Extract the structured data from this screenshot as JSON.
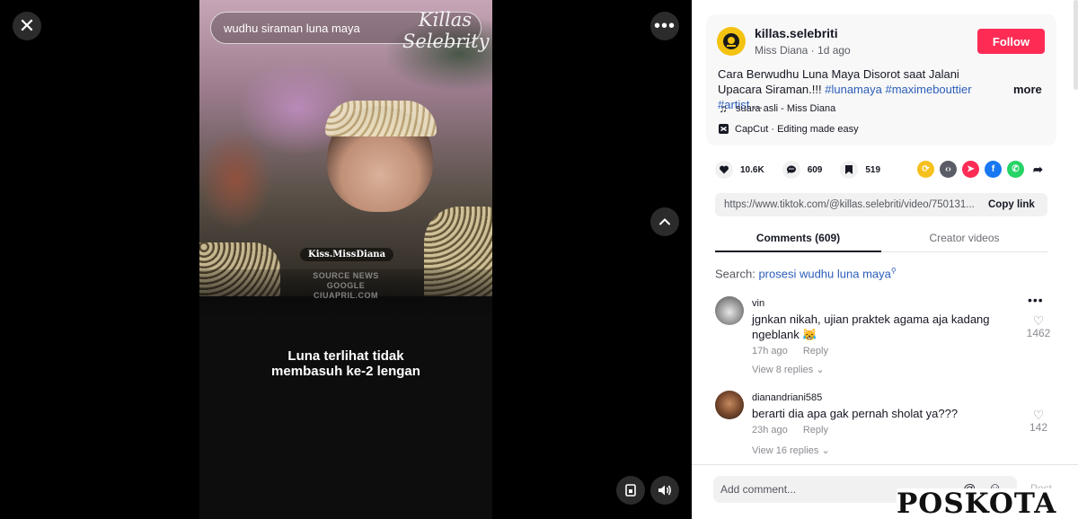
{
  "video": {
    "search_text": "wudhu siraman luna maya",
    "brand_overlay": "Killas Selebrity",
    "watermark": "Kiss.MissDiana",
    "source_lines": [
      "SOURCE NEWS",
      "GOOGLE",
      "CIUAPRIL.COM"
    ],
    "caption_line1": "Luna terlihat tidak",
    "caption_line2": "membasuh ke-2 lengan"
  },
  "post": {
    "username": "killas.selebriti",
    "subline": "Miss Diana · 1d ago",
    "follow_label": "Follow",
    "description": "Cara Berwudhu Luna Maya Disorot saat Jalani Upacara Siraman.!!!",
    "hashtags": [
      "#lunamaya",
      "#maximebouttier",
      "#artist"
    ],
    "ellipsis": "...",
    "more_label": "more",
    "music": "suara asli - Miss Diana",
    "capcut": "CapCut · Editing made easy"
  },
  "actions": {
    "likes": "10.6K",
    "comments": "609",
    "saves": "519"
  },
  "share_colors": [
    "#f7c01e",
    "#5a5c66",
    "#fe2c55",
    "#1877f2",
    "#25d366"
  ],
  "link": {
    "url": "https://www.tiktok.com/@killas.selebriti/video/750131...",
    "copy_label": "Copy link"
  },
  "tabs": {
    "comments": "Comments (609)",
    "creator": "Creator videos"
  },
  "comment_search": {
    "prefix": "Search:",
    "query": "prosesi wudhu luna maya"
  },
  "comments": [
    {
      "user": "vin",
      "text": "jgnkan nikah, ujian praktek agama aja kadang ngeblank 😹",
      "time": "17h ago",
      "reply_label": "Reply",
      "view_replies": "View 8 replies",
      "likes": "1462"
    },
    {
      "user": "dianandriani585",
      "text": "berarti dia apa gak pernah sholat ya???",
      "time": "23h ago",
      "reply_label": "Reply",
      "view_replies": "View 16 replies",
      "likes": "142"
    }
  ],
  "input": {
    "placeholder": "Add comment...",
    "post_label": "Post"
  },
  "watermark_logo": "POSKOTA"
}
